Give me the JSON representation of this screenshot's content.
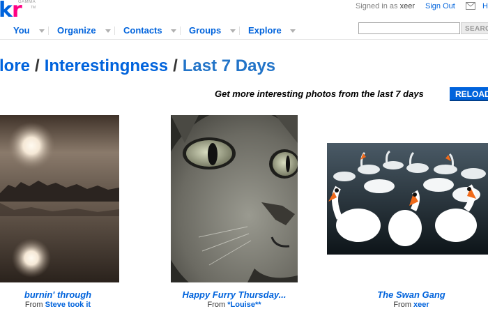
{
  "brand": {
    "logo_text": "kr",
    "beta_tag": "GAMMA",
    "tm": "TM"
  },
  "account": {
    "signed_in_prefix": "Signed in as",
    "username": "xeer",
    "sign_out": "Sign Out",
    "help_partial": "H"
  },
  "nav": {
    "items": [
      {
        "label": "You"
      },
      {
        "label": "Organize"
      },
      {
        "label": "Contacts"
      },
      {
        "label": "Groups"
      },
      {
        "label": "Explore"
      }
    ]
  },
  "search": {
    "value": "",
    "button_label": "SEARCH"
  },
  "breadcrumb": {
    "part1": "lore",
    "sep1": "/",
    "part2": "Interestingness",
    "sep2": "/",
    "current": "Last 7 Days"
  },
  "promo": {
    "text": "Get more interesting photos from the last 7 days",
    "reload_label": "RELOAD"
  },
  "photos": [
    {
      "title": "burnin' through",
      "from_label": "From",
      "owner": "Steve took it"
    },
    {
      "title": "Happy Furry Thursday...",
      "from_label": "From",
      "owner": "*Louise**"
    },
    {
      "title": "The Swan Gang",
      "from_label": "From",
      "owner": "xeer"
    }
  ],
  "colors": {
    "link": "#0063dc",
    "pink": "#ff0084",
    "reload_bg": "#0063dc"
  }
}
